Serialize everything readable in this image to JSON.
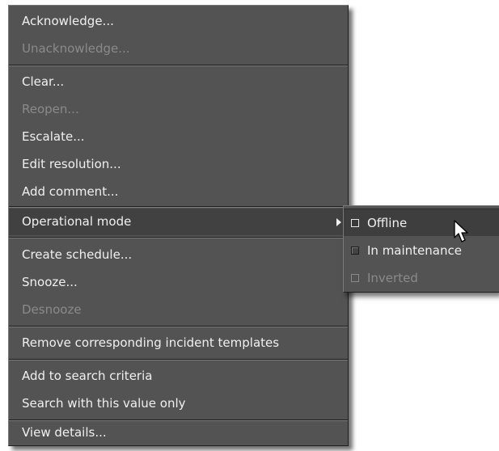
{
  "context_menu": {
    "items": [
      {
        "label": "Acknowledge...",
        "enabled": true
      },
      {
        "label": "Unacknowledge...",
        "enabled": false
      },
      {
        "label": "Clear...",
        "enabled": true
      },
      {
        "label": "Reopen...",
        "enabled": false
      },
      {
        "label": "Escalate...",
        "enabled": true
      },
      {
        "label": "Edit resolution...",
        "enabled": true
      },
      {
        "label": "Add comment...",
        "enabled": true
      },
      {
        "label": "Operational mode",
        "enabled": true,
        "has_submenu": true
      },
      {
        "label": "Create schedule...",
        "enabled": true
      },
      {
        "label": "Snooze...",
        "enabled": true
      },
      {
        "label": "Desnooze",
        "enabled": false
      },
      {
        "label": "Remove corresponding incident templates",
        "enabled": true
      },
      {
        "label": "Add to search criteria",
        "enabled": true
      },
      {
        "label": "Search with this value only",
        "enabled": true
      },
      {
        "label": "View details...",
        "enabled": true
      }
    ]
  },
  "submenu": {
    "items": [
      {
        "label": "Offline",
        "enabled": true,
        "checked": false
      },
      {
        "label": "In maintenance",
        "enabled": true,
        "checked": false
      },
      {
        "label": "Inverted",
        "enabled": false,
        "checked": false
      }
    ]
  },
  "icons": {
    "submenu_arrow": "chevron-right-icon",
    "pointer": "mouse-pointer-icon"
  },
  "colors": {
    "menu_background": "#535353",
    "text": "#f0f0f0",
    "disabled_text": "#8a8a8a",
    "active_item": "#414141"
  }
}
